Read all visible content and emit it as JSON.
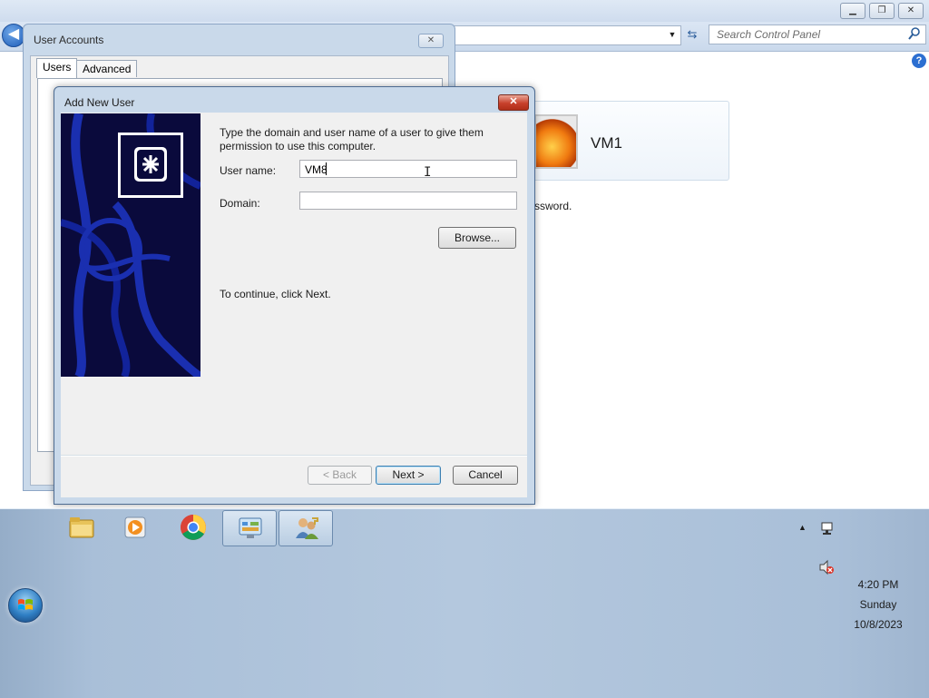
{
  "control_panel": {
    "search_placeholder": "Search Control Panel",
    "user_tile_name": "VM1",
    "password_text_fragment": "ssword."
  },
  "user_accounts": {
    "title": "User Accounts",
    "tabs": [
      {
        "label": "Users",
        "active": true
      },
      {
        "label": "Advanced",
        "active": false
      }
    ]
  },
  "add_user_dialog": {
    "title": "Add New User",
    "intro": "Type the domain and user name of a user to give them permission to use this computer.",
    "username_label": "User name:",
    "username_value": "VM8",
    "domain_label": "Domain:",
    "domain_value": "",
    "browse_label": "Browse...",
    "continue_text": "To continue, click Next.",
    "back_label": "< Back",
    "next_label": "Next >",
    "cancel_label": "Cancel",
    "close_glyph": "✕"
  },
  "taskbar": {
    "pinned": [
      {
        "name": "windows-explorer",
        "icon": "folder-icon",
        "active": false
      },
      {
        "name": "media-player",
        "icon": "media-player-icon",
        "active": false
      },
      {
        "name": "chrome",
        "icon": "chrome-icon",
        "active": false
      },
      {
        "name": "control-panel",
        "icon": "control-panel-icon",
        "active": true
      },
      {
        "name": "user-accounts",
        "icon": "users-icon",
        "active": true
      }
    ],
    "clock": {
      "time": "4:20 PM",
      "day": "Sunday",
      "date": "10/8/2023"
    }
  },
  "colors": {
    "dialog_banner": "#0a0a3c",
    "taskbar": "#b4c8de",
    "window_frame": "#c9d9ea",
    "close_button": "#c8402b"
  }
}
